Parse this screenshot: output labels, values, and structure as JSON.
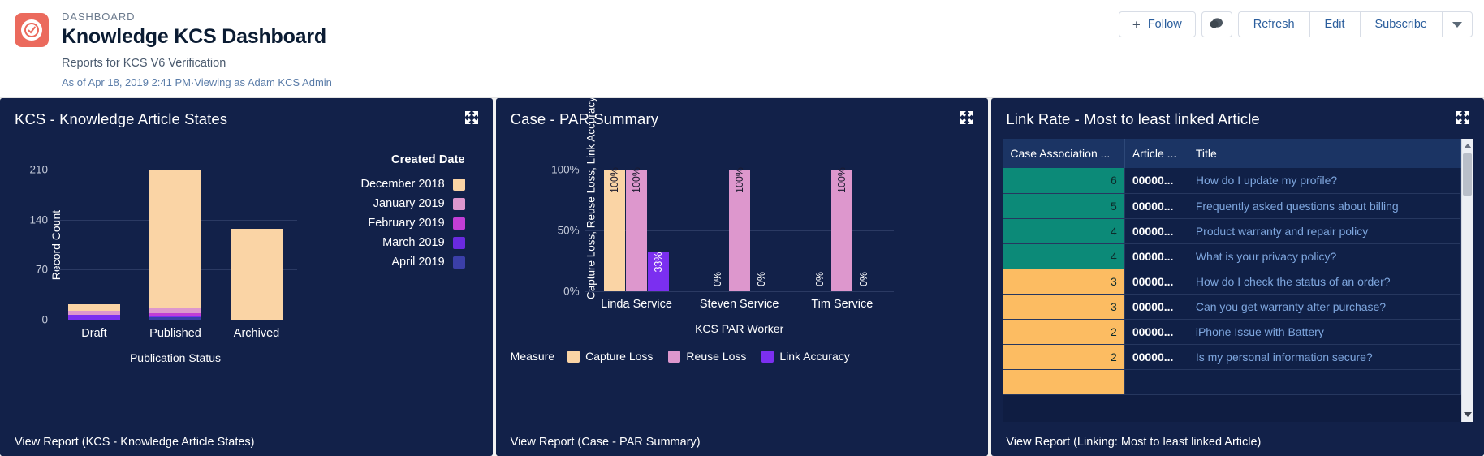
{
  "header": {
    "eyebrow": "DASHBOARD",
    "title": "Knowledge KCS Dashboard",
    "subtitle": "Reports for KCS V6 Verification",
    "as_of": "As of Apr 18, 2019 2:41 PM·Viewing as Adam KCS Admin",
    "brand_icon": "salesforce-app-icon",
    "actions": {
      "follow": "Follow",
      "follow_plus": "+",
      "chatter_icon": "chatter-icon",
      "refresh": "Refresh",
      "edit": "Edit",
      "subscribe": "Subscribe",
      "more_icon": "chevron-down-icon"
    }
  },
  "colors": {
    "card_bg": "#122149",
    "accent_link": "#7ea6de",
    "peach": "#fad4a5",
    "pink": "#dd97cd",
    "magenta": "#c23ed6",
    "purple": "#7b2ff0",
    "indigo": "#3b3fa8",
    "teal_cell": "#0c8a78",
    "orange_cell": "#fcbc62",
    "brand_red": "#eb6a5d"
  },
  "panels": [
    {
      "title": "KCS - Knowledge Article States",
      "view_report": "View Report (KCS - Knowledge Article States)",
      "expand_icon": "expand-icon"
    },
    {
      "title": "Case - PAR Summary",
      "view_report": "View Report (Case - PAR Summary)",
      "expand_icon": "expand-icon"
    },
    {
      "title": "Link Rate - Most to least linked Article",
      "view_report": "View Report (Linking: Most to least linked Article)",
      "expand_icon": "expand-icon"
    }
  ],
  "chart_data": [
    {
      "type": "bar",
      "title": "KCS - Knowledge Article States",
      "stacked": true,
      "xlabel": "Publication Status",
      "ylabel": "Record Count",
      "categories": [
        "Draft",
        "Published",
        "Archived"
      ],
      "yticks": [
        "0",
        "70",
        "140",
        "210"
      ],
      "ylim": [
        0,
        210
      ],
      "grid": true,
      "legend_title": "Created Date",
      "legend_position": "right",
      "series": [
        {
          "name": "December 2018",
          "color": "#fad4a5",
          "values": [
            8,
            198,
            127
          ]
        },
        {
          "name": "January 2019",
          "color": "#dd97cd",
          "values": [
            6,
            7,
            0
          ]
        },
        {
          "name": "February 2019",
          "color": "#c23ed6",
          "values": [
            0,
            3,
            0
          ]
        },
        {
          "name": "March 2019",
          "color": "#7b2ff0",
          "values": [
            7,
            2,
            0
          ]
        },
        {
          "name": "April 2019",
          "color": "#3b3fa8",
          "values": [
            0,
            4,
            0
          ]
        }
      ]
    },
    {
      "type": "bar",
      "title": "Case - PAR Summary",
      "stacked": false,
      "xlabel": "KCS PAR Worker",
      "ylabel": "Capture Loss, Reuse Loss, Link Accuracy",
      "categories": [
        "Linda Service",
        "Steven Service",
        "Tim Service"
      ],
      "yticks": [
        "0%",
        "50%",
        "100%"
      ],
      "ylim": [
        0,
        100
      ],
      "grid": true,
      "legend_title": "Measure",
      "legend_position": "bottom",
      "series": [
        {
          "name": "Capture Loss",
          "color": "#fad4a5",
          "values": [
            100,
            0,
            0
          ],
          "labels": [
            "100%",
            "0%",
            "0%"
          ]
        },
        {
          "name": "Reuse Loss",
          "color": "#dd97cd",
          "values": [
            100,
            100,
            100
          ],
          "labels": [
            "100%",
            "100%",
            "100%"
          ]
        },
        {
          "name": "Link Accuracy",
          "color": "#7b2ff0",
          "values": [
            33,
            0,
            0
          ],
          "labels": [
            "33%",
            "0%",
            "0%"
          ]
        }
      ]
    }
  ],
  "table": {
    "columns": [
      "Case Association ...",
      "Article ...",
      "Title"
    ],
    "rows": [
      {
        "count": "6",
        "article": "00000...",
        "title": "How do I update my profile?",
        "band": "teal"
      },
      {
        "count": "5",
        "article": "00000...",
        "title": "Frequently asked questions about billing",
        "band": "teal"
      },
      {
        "count": "4",
        "article": "00000...",
        "title": "Product warranty and repair policy",
        "band": "teal"
      },
      {
        "count": "4",
        "article": "00000...",
        "title": "What is your privacy policy?",
        "band": "teal"
      },
      {
        "count": "3",
        "article": "00000...",
        "title": "How do I check the status of an order?",
        "band": "orange"
      },
      {
        "count": "3",
        "article": "00000...",
        "title": "Can you get warranty after purchase?",
        "band": "orange"
      },
      {
        "count": "2",
        "article": "00000...",
        "title": "iPhone Issue with Battery",
        "band": "orange"
      },
      {
        "count": "2",
        "article": "00000...",
        "title": "Is my personal information secure?",
        "band": "orange"
      }
    ],
    "scrollbar": {
      "up_icon": "scroll-up-arrow",
      "down_icon": "scroll-down-arrow"
    }
  }
}
